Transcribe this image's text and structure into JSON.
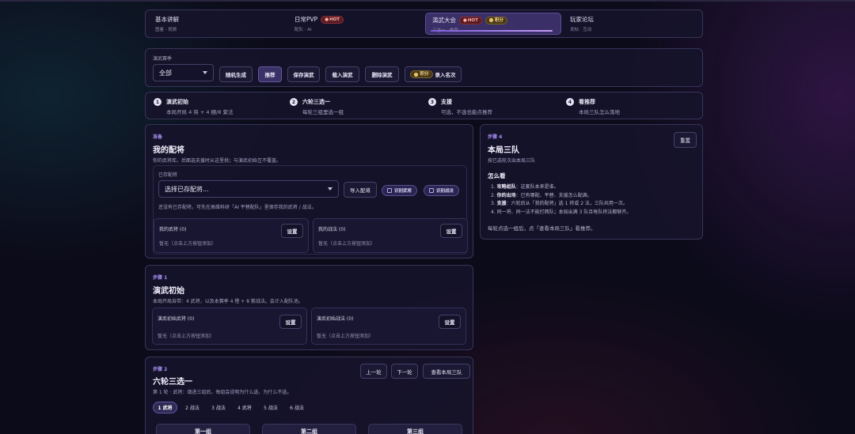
{
  "nav": {
    "items": [
      {
        "title": "基本讲解",
        "sub": "图鉴 · 视频"
      },
      {
        "title": "日常PVP",
        "sub": "配队 · AI",
        "badge": "HOT"
      },
      {
        "title": "演武大会",
        "sub": "三选一 · 推荐",
        "badge": "HOT",
        "badge2": "积分"
      },
      {
        "title": "玩家论坛",
        "sub": "发帖 · 互动"
      }
    ]
  },
  "season": {
    "label": "演武赛季",
    "selected": "全部",
    "buttons": [
      "随机生成",
      "推荐",
      "保存演武",
      "载入演武",
      "删除演武"
    ],
    "record_badge": "积分",
    "record_label": "录入名次"
  },
  "steps": [
    {
      "num": "1",
      "title": "演武初始",
      "sub": "本局开局 4 将 + 4 棚/8 紫法"
    },
    {
      "num": "2",
      "title": "六轮三选一",
      "sub": "每轮三组里选一组"
    },
    {
      "num": "3",
      "title": "支援",
      "sub": "可选，不选也能点推荐"
    },
    {
      "num": "4",
      "title": "看推荐",
      "sub": "本局三队怎么落地"
    }
  ],
  "config": {
    "tag": "准备",
    "title": "我的配将",
    "desc": "你的武将库。后面选支援时从这里挑；与演武初始互不覆盖。",
    "saved_label": "已存配将",
    "saved_placeholder": "选择已存配将...",
    "import_btn": "导入配将",
    "pill1": "识别武将",
    "pill2": "识别战法",
    "hint": "还没有已存配将。可先在高维科研「AI 平替配队」里保存我的武将 / 战法。",
    "generals_title": "我的武将 (0)",
    "generals_empty": "暂无（点击上方按钮添加）",
    "tactics_title": "我的战法 (0)",
    "tactics_empty": "暂无（点击上方按钮添加）",
    "set_label": "设置"
  },
  "step1": {
    "tag": "步骤 1",
    "title": "演武初始",
    "desc": "本局开局自带：4 武将，以及本赛季 4 橙 + 8 紫战法。会计入配队池。",
    "generals_title": "演武初始武将 (0)",
    "generals_empty": "暂无（点击上方按钮添加）",
    "tactics_title": "演武初始战法 (0)",
    "tactics_empty": "暂无（点击上方按钮添加）",
    "set_label": "设置"
  },
  "step2": {
    "tag": "步骤 2",
    "title": "六轮三选一",
    "desc": "第 1 轮 · 武将：填进三组后，每组会说明为什么选、为什么不选。",
    "prev": "上一轮",
    "next": "下一轮",
    "view": "查看本局三队",
    "tabs": [
      "1 武将",
      "2 战法",
      "3 战法",
      "4 武将",
      "5 战法",
      "6 战法"
    ],
    "groups": [
      "第一组",
      "第二组",
      "第三组"
    ]
  },
  "step4": {
    "tag": "步骤 4",
    "title": "本局三队",
    "desc": "按已选轮次出本局三队",
    "reset": "重置",
    "how_title": "怎么看",
    "how": [
      {
        "n": "1.",
        "b": "攻略组队",
        "t": "：这套队本来是谁。"
      },
      {
        "n": "2.",
        "b": "你的出场",
        "t": "：已有哪配、平替、支援怎么配满。"
      },
      {
        "n": "3.",
        "b": "支援",
        "t": "：六轮后从「我的配将」选 1 将或 2 法，三队共用一次。"
      },
      {
        "n": "4.",
        "b": "",
        "t": "同一将、同一法不能打两队；本局出满 3 队且每队将法都够齐。"
      }
    ],
    "footer": "每轮点选一组后，点「查看本局三队」看推荐。"
  }
}
